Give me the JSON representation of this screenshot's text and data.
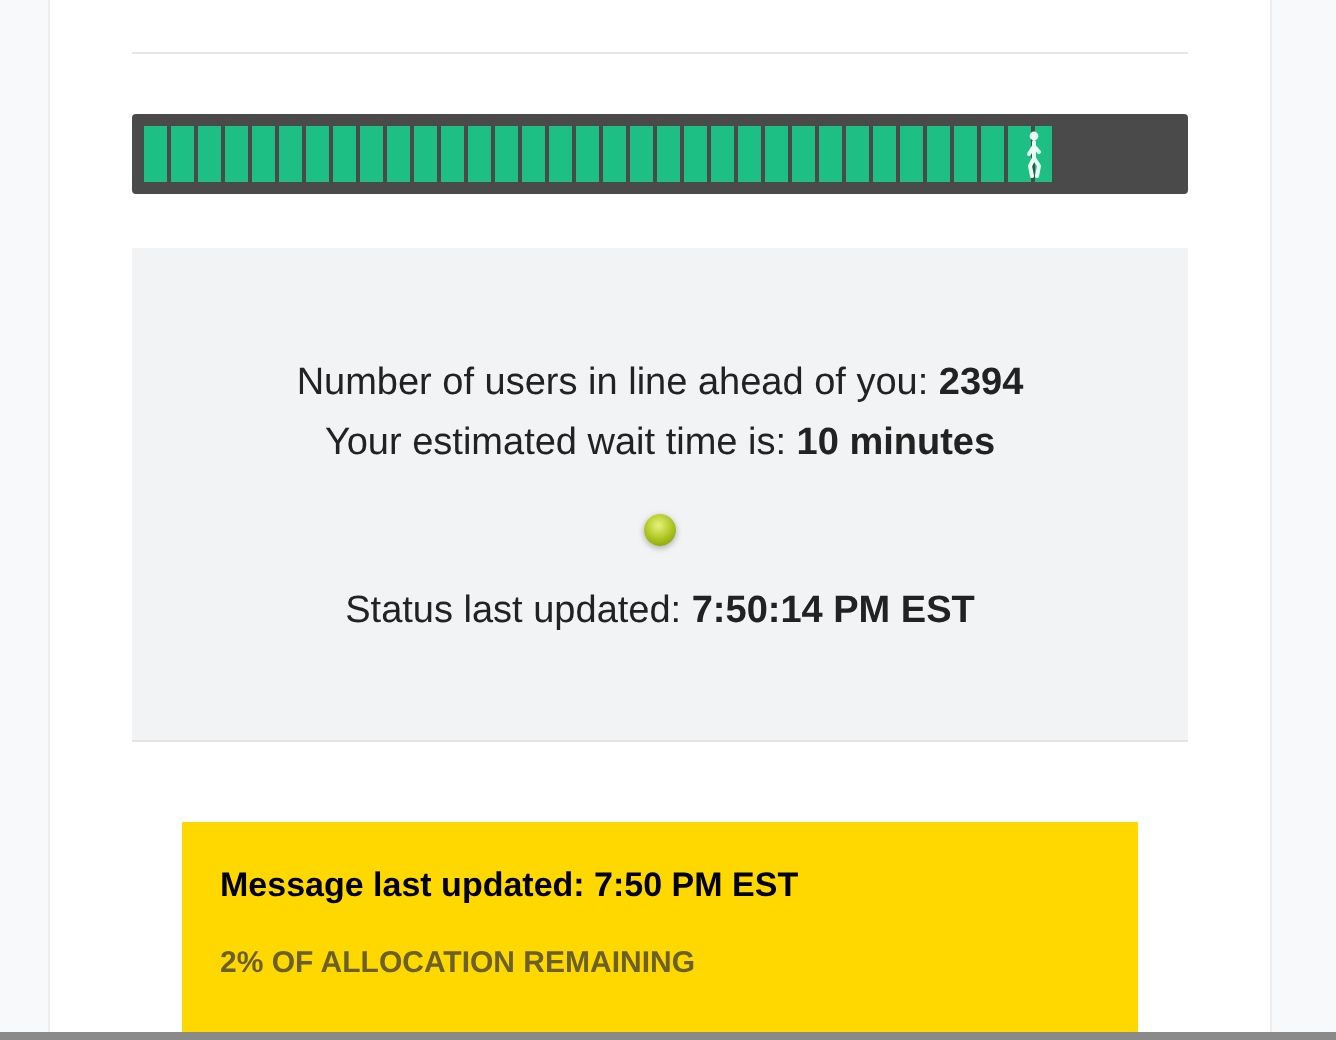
{
  "queue_progress": {
    "level": 0.88
  },
  "status_panel": {
    "users_ahead": "Number of users in line ahead of you: **2394**",
    "wait_time": "Your estimated wait time is: **10 minutes**",
    "status_updated": "Status last updated: **7:50:14 PM EST**"
  },
  "message": {
    "updated": "Message last updated: 7:50 PM EST",
    "text": "2% OF ALLOCATION REMAINING"
  }
}
